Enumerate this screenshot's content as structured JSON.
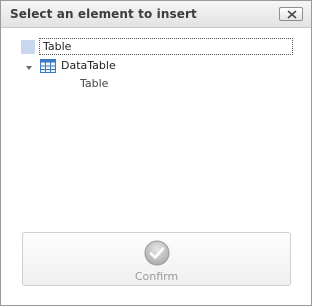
{
  "window": {
    "title": "Select an element to insert",
    "close_icon": "close-icon"
  },
  "tree": {
    "root": {
      "label": "Table",
      "selected": true
    },
    "nodes": [
      {
        "label": "DataTable",
        "icon": "table-grid-icon",
        "expanded": true,
        "children": [
          {
            "label": "Table"
          }
        ]
      }
    ]
  },
  "footer": {
    "confirm_label": "Confirm",
    "confirm_icon": "checkmark-icon",
    "confirm_enabled": false
  },
  "colors": {
    "selection": "#c8d7ee",
    "table_icon_blue": "#3a78c3",
    "disabled_text": "#9a9a9a"
  }
}
